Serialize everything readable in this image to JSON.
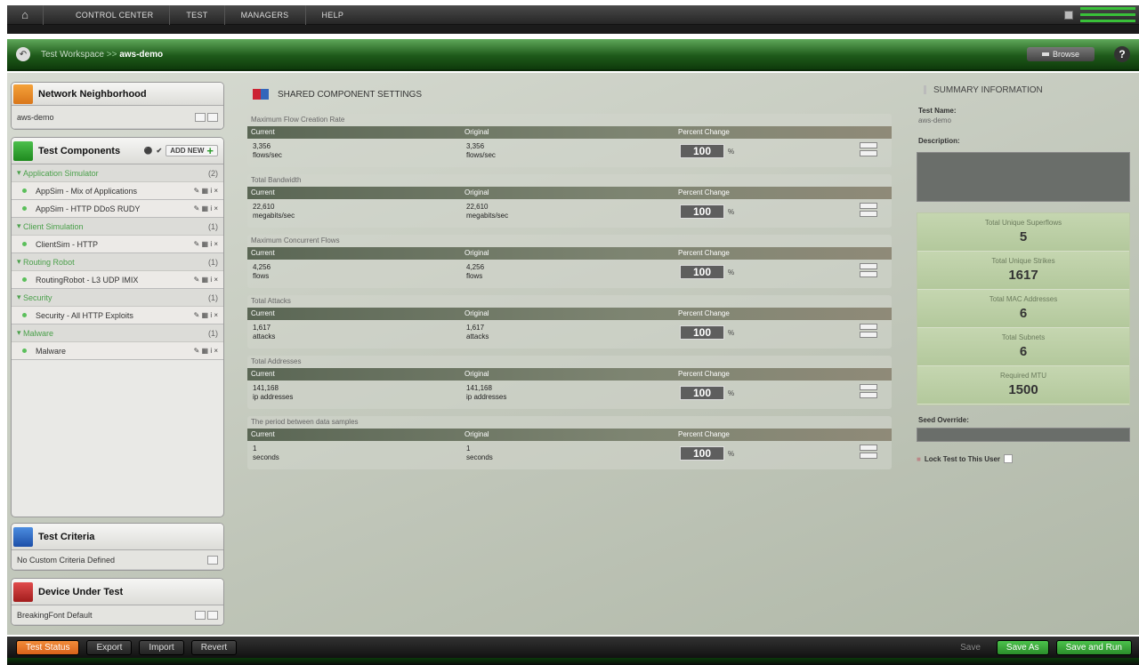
{
  "top_menu": {
    "items": [
      "CONTROL CENTER",
      "TEST",
      "MANAGERS",
      "HELP"
    ]
  },
  "breadcrumb": {
    "root": "Test Workspace",
    "sep": ">>",
    "current": "aws-demo"
  },
  "browse_label": "Browse",
  "help_label": "?",
  "network": {
    "title": "Network Neighborhood",
    "value": "aws-demo"
  },
  "components": {
    "title": "Test Components",
    "add_label": "ADD NEW",
    "categories": [
      {
        "name": "Application Simulator",
        "count": "(2)",
        "items": [
          "AppSim - Mix of Applications",
          "AppSim - HTTP DDoS RUDY"
        ]
      },
      {
        "name": "Client Simulation",
        "count": "(1)",
        "items": [
          "ClientSim - HTTP"
        ]
      },
      {
        "name": "Routing Robot",
        "count": "(1)",
        "items": [
          "RoutingRobot - L3 UDP IMIX"
        ]
      },
      {
        "name": "Security",
        "count": "(1)",
        "items": [
          "Security - All HTTP Exploits"
        ]
      },
      {
        "name": "Malware",
        "count": "(1)",
        "items": [
          "Malware"
        ]
      }
    ]
  },
  "criteria": {
    "title": "Test Criteria",
    "value": "No Custom Criteria Defined"
  },
  "dut": {
    "title": "Device Under Test",
    "value": "BreakingFont Default"
  },
  "shared": {
    "title": "SHARED COMPONENT SETTINGS",
    "col_current": "Current",
    "col_original": "Original",
    "col_pct": "Percent Change",
    "pct_value": "100",
    "pct_sign": "%",
    "blocks": [
      {
        "title": "Maximum Flow Creation Rate",
        "cur": "3,356",
        "cur_unit": "flows/sec",
        "orig": "3,356",
        "orig_unit": "flows/sec"
      },
      {
        "title": "Total Bandwidth",
        "cur": "22,610",
        "cur_unit": "megabits/sec",
        "orig": "22,610",
        "orig_unit": "megabits/sec"
      },
      {
        "title": "Maximum Concurrent Flows",
        "cur": "4,256",
        "cur_unit": "flows",
        "orig": "4,256",
        "orig_unit": "flows"
      },
      {
        "title": "Total Attacks",
        "cur": "1,617",
        "cur_unit": "attacks",
        "orig": "1,617",
        "orig_unit": "attacks"
      },
      {
        "title": "Total Addresses",
        "cur": "141,168",
        "cur_unit": "ip addresses",
        "orig": "141,168",
        "orig_unit": "ip addresses"
      },
      {
        "title": "The period between data samples",
        "cur": "1",
        "cur_unit": "seconds",
        "orig": "1",
        "orig_unit": "seconds"
      }
    ]
  },
  "summary": {
    "title": "SUMMARY INFORMATION",
    "test_name_label": "Test Name:",
    "test_name": "aws-demo",
    "description_label": "Description:",
    "stats": [
      {
        "label": "Total Unique Superflows",
        "value": "5"
      },
      {
        "label": "Total Unique Strikes",
        "value": "1617"
      },
      {
        "label": "Total MAC Addresses",
        "value": "6"
      },
      {
        "label": "Total Subnets",
        "value": "6"
      },
      {
        "label": "Required MTU",
        "value": "1500"
      }
    ],
    "seed_label": "Seed Override:",
    "lock_label": "Lock Test to This User"
  },
  "bottom": {
    "test_status": "Test Status",
    "export": "Export",
    "import": "Import",
    "revert": "Revert",
    "save": "Save",
    "save_as": "Save As",
    "save_run": "Save and Run"
  }
}
